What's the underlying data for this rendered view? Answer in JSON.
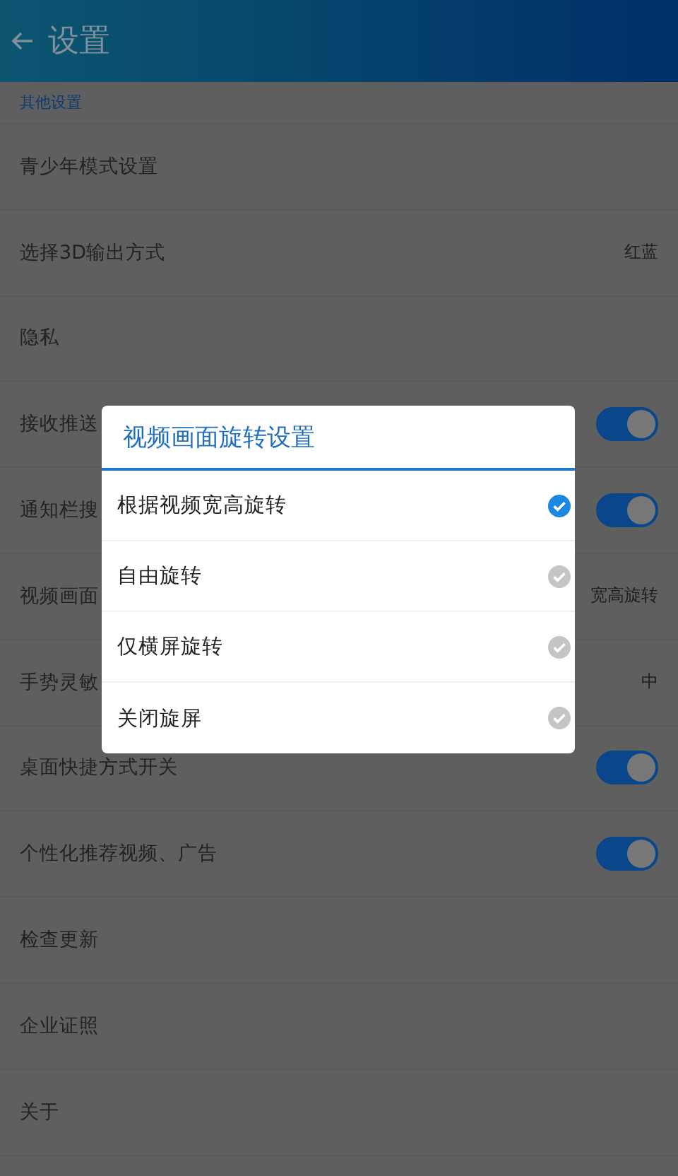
{
  "header": {
    "title": "设置"
  },
  "section": {
    "title": "其他设置"
  },
  "rows": [
    {
      "kind": "link",
      "label": "青少年模式设置"
    },
    {
      "kind": "value",
      "label": "选择3D输出方式",
      "value": "红蓝"
    },
    {
      "kind": "link",
      "label": "隐私"
    },
    {
      "kind": "toggle",
      "label": "接收推送",
      "on": true
    },
    {
      "kind": "toggle",
      "label": "通知栏搜",
      "on": true
    },
    {
      "kind": "value",
      "label": "视频画面",
      "value": "宽高旋转"
    },
    {
      "kind": "value",
      "label": "手势灵敏",
      "value": "中"
    },
    {
      "kind": "toggle",
      "label": "桌面快捷方式开关",
      "on": true
    },
    {
      "kind": "toggle",
      "label": "个性化推荐视频、广告",
      "on": true
    },
    {
      "kind": "link",
      "label": "检查更新"
    },
    {
      "kind": "link",
      "label": "企业证照"
    },
    {
      "kind": "link",
      "label": "关于"
    }
  ],
  "dialog": {
    "title": "视频画面旋转设置",
    "options": [
      {
        "label": "根据视频宽高旋转",
        "selected": true
      },
      {
        "label": "自由旋转",
        "selected": false
      },
      {
        "label": "仅横屏旋转",
        "selected": false
      },
      {
        "label": "关闭旋屏",
        "selected": false
      }
    ]
  }
}
